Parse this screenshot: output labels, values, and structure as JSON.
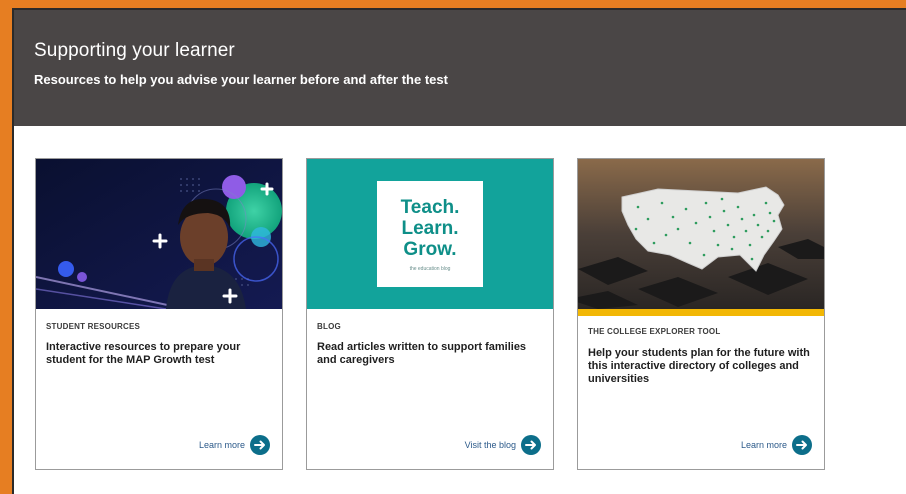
{
  "header": {
    "title": "Supporting your learner",
    "subtitle": "Resources to help you advise your learner before and after the test"
  },
  "cards": [
    {
      "eyebrow": "STUDENT RESOURCES",
      "text": "Interactive resources to prepare your student for the MAP Growth test",
      "link": "Learn more",
      "image": "student-photo"
    },
    {
      "eyebrow": "BLOG",
      "text": "Read articles written to support families and caregivers",
      "link": "Visit the blog",
      "image": "blog-logo",
      "logo_words": [
        "Teach.",
        "Learn.",
        "Grow."
      ],
      "logo_tagline": "the education blog"
    },
    {
      "eyebrow": "THE COLLEGE EXPLORER TOOL",
      "text": "Help your students plan for the future with this interactive directory of colleges and universities",
      "link": "Learn more",
      "image": "us-map-photo"
    }
  ],
  "colors": {
    "frame": "#e67e22",
    "header_bg": "#4a4646",
    "teal": "#12a39b",
    "gold": "#f2b705",
    "button": "#0c6e8a"
  },
  "icons": {
    "link_arrow": "arrow-right-circle-icon"
  }
}
